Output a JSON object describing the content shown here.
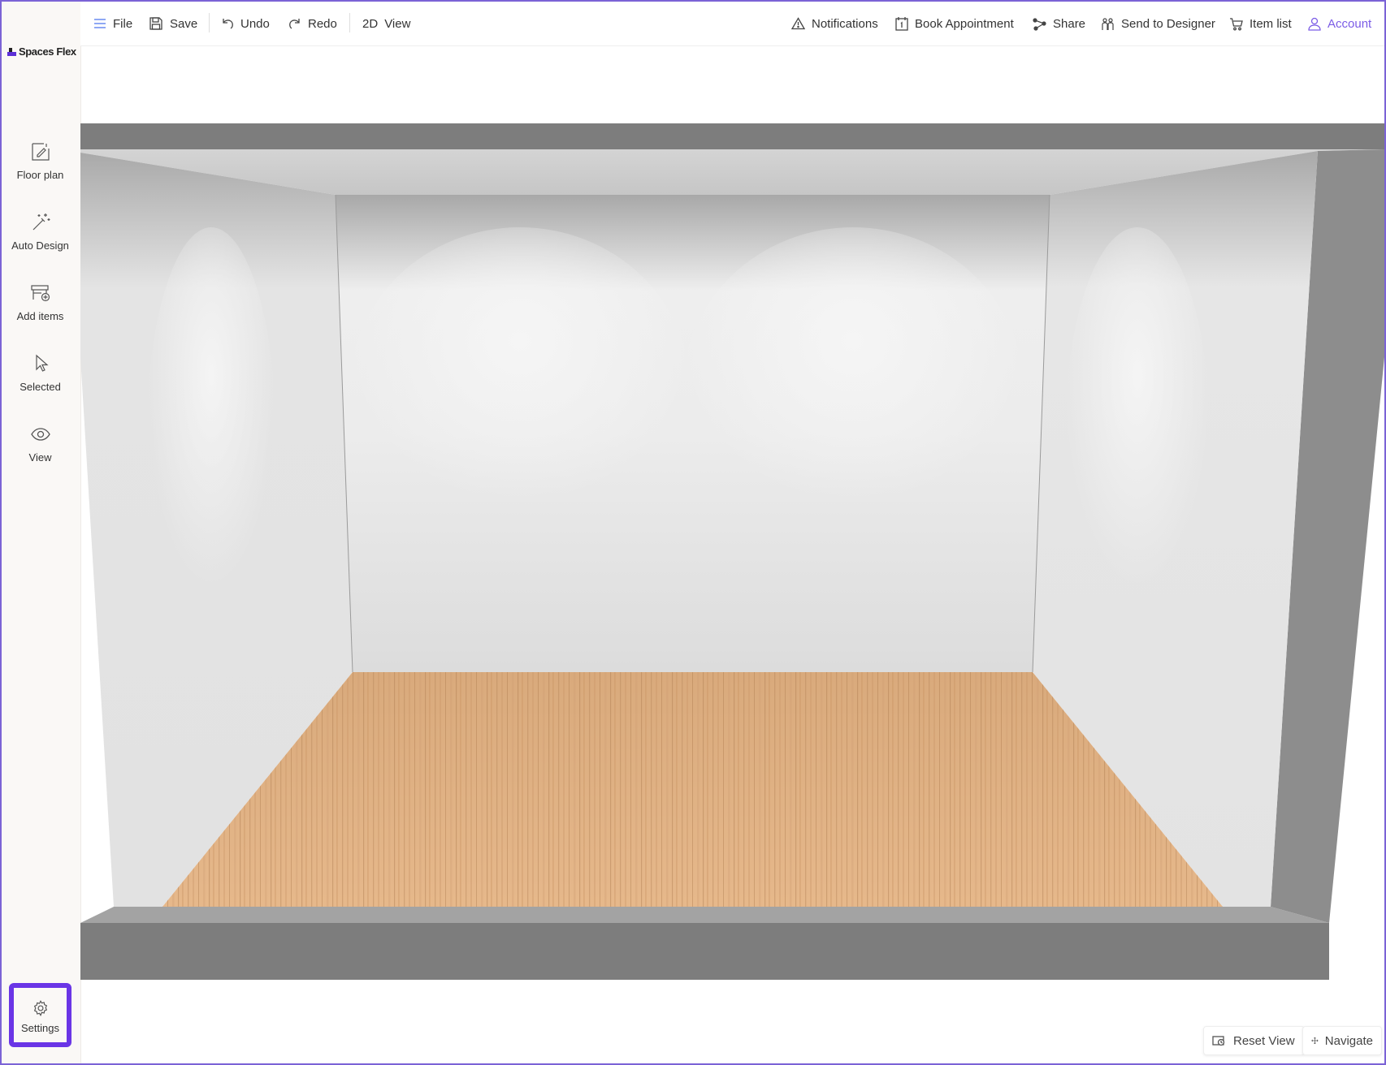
{
  "brand": {
    "name": "Spaces Flex",
    "accent": "#6a35e6"
  },
  "toolbar": {
    "file": "File",
    "save": "Save",
    "undo": "Undo",
    "redo": "Redo",
    "view_mode": "2D",
    "view": "View",
    "notifications": "Notifications",
    "book_appointment": "Book Appointment",
    "share": "Share",
    "send_to_designer": "Send to Designer",
    "item_list": "Item list",
    "account": "Account"
  },
  "sidebar": {
    "items": [
      {
        "label": "Floor plan",
        "icon": "floor-plan-icon"
      },
      {
        "label": "Auto Design",
        "icon": "magic-wand-icon"
      },
      {
        "label": "Add items",
        "icon": "add-items-icon"
      },
      {
        "label": "Selected",
        "icon": "cursor-icon"
      },
      {
        "label": "View",
        "icon": "eye-icon"
      }
    ],
    "settings": "Settings"
  },
  "bottom": {
    "reset_view": "Reset View",
    "navigate": "Navigate"
  }
}
